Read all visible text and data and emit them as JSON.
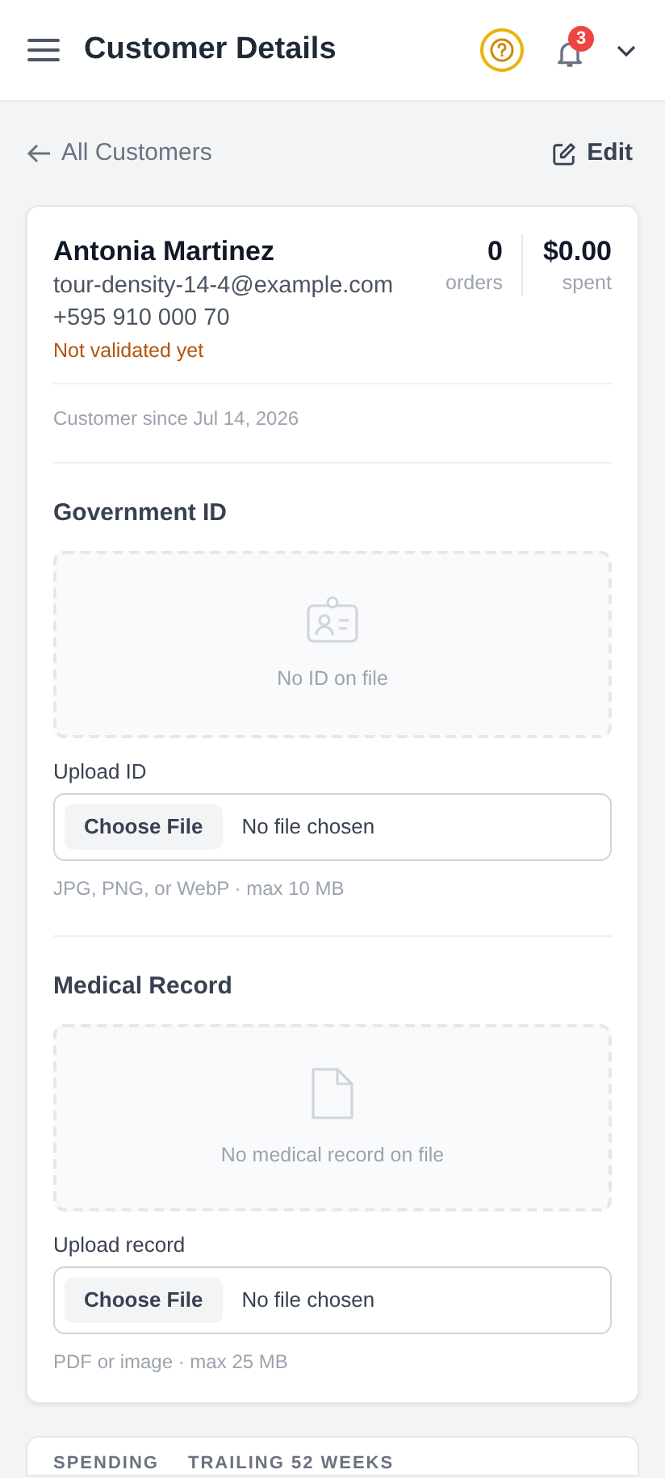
{
  "header": {
    "title": "Customer Details",
    "notification_count": "3"
  },
  "nav": {
    "back_label": "All Customers",
    "edit_label": "Edit"
  },
  "customer": {
    "name": "Antonia Martinez",
    "email": "tour-density-14-4@example.com",
    "phone": "+595 910 000 70",
    "validation": "Not validated yet",
    "validated": false,
    "since": "Customer since Jul 14, 2026",
    "stats": [
      {
        "value": "0",
        "label": "orders"
      },
      {
        "value": "$0.00",
        "label": "spent"
      }
    ]
  },
  "documents": [
    {
      "kind": "id",
      "title": "Government ID",
      "empty_text": "No ID on file",
      "upload_label": "Upload ID",
      "button": "Choose File",
      "status": "No file chosen",
      "hint": "JPG, PNG, or WebP · max 10 MB"
    },
    {
      "kind": "record",
      "title": "Medical Record",
      "empty_text": "No medical record on file",
      "upload_label": "Upload record",
      "button": "Choose File",
      "status": "No file chosen",
      "hint": "PDF or image · max 25 MB"
    }
  ],
  "spending": {
    "title": "SPENDING",
    "subtitle": "TRAILING 52 WEEKS"
  }
}
